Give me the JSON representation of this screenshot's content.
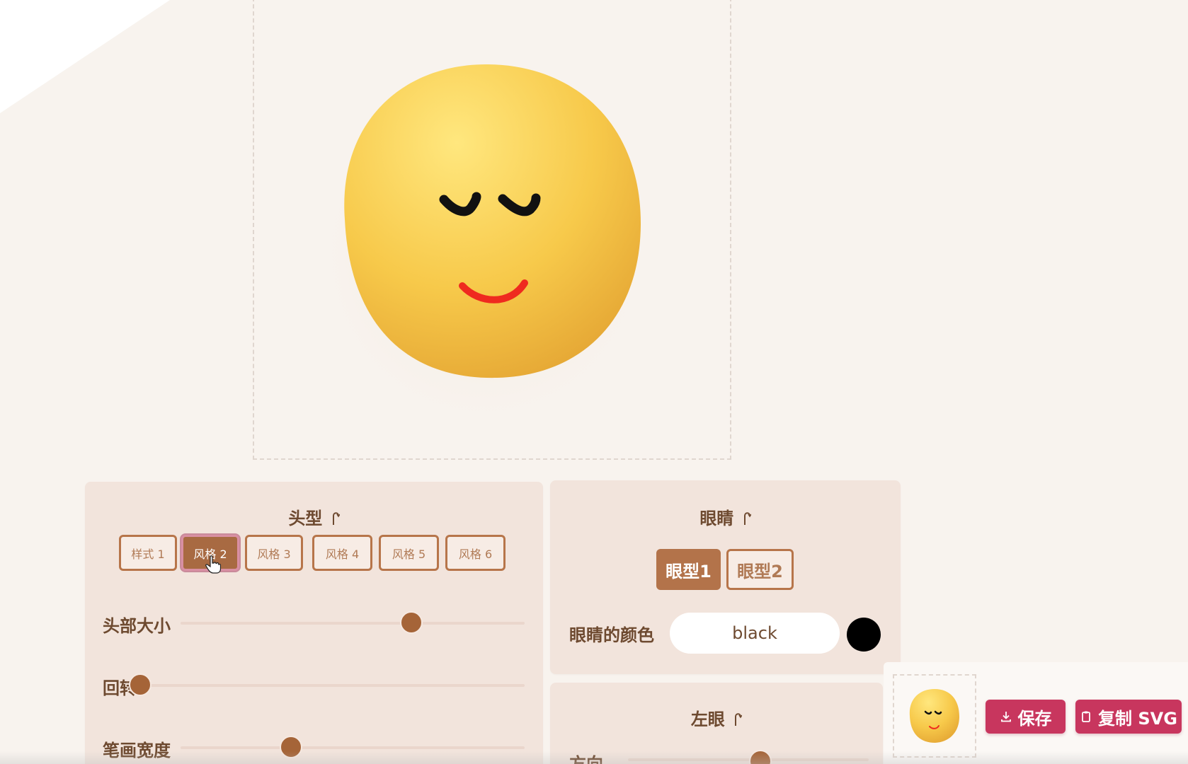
{
  "colors": {
    "background": "#f8f3ee",
    "panel": "#f2e4dc",
    "accent_brown": "#a86a42",
    "action_pink": "#c8365e",
    "face_yellow": "#f7c94a",
    "mouth_red": "#ef2a1f"
  },
  "head_panel": {
    "title": "头型",
    "styles": [
      "样式 1",
      "风格 2",
      "风格 3",
      "风格 4",
      "风格 5",
      "风格 6"
    ],
    "selected_style": "风格 2",
    "sliders": [
      {
        "label": "头部大小",
        "value_fraction": 0.67
      },
      {
        "label": "回转",
        "value_fraction": 0.0
      },
      {
        "label": "笔画宽度",
        "value_fraction": 0.32
      }
    ]
  },
  "eyes_panel": {
    "title": "眼睛",
    "types": [
      "眼型1",
      "眼型2"
    ],
    "selected_type": "眼型1",
    "color_label": "眼睛的颜色",
    "color_value": "black",
    "swatch_color": "#000000"
  },
  "left_eye_panel": {
    "title": "左眼",
    "slider_label": "方向",
    "value_fraction": 0.55
  },
  "toolbar": {
    "save_label": "保存",
    "copy_label": "复制 SVG"
  },
  "icons": [
    "refresh-icon",
    "download-icon",
    "clipboard-icon",
    "hand-pointer-icon"
  ]
}
